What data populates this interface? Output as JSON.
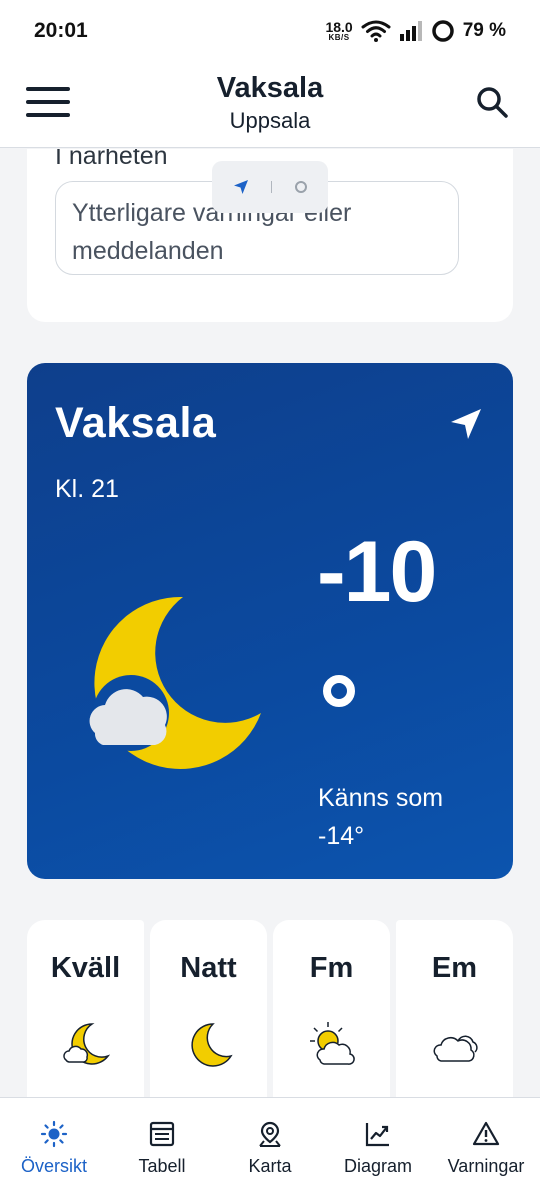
{
  "status_bar": {
    "time": "20:01",
    "net_speed_value": "18.0",
    "net_speed_unit": "KB/S",
    "battery": "79 %"
  },
  "header": {
    "title": "Vaksala",
    "subtitle": "Uppsala"
  },
  "warnings_card": {
    "heading": "I närheten",
    "more_text": "Ytterligare varningar eller meddelanden"
  },
  "current_weather": {
    "location": "Vaksala",
    "time": "Kl. 21",
    "temperature": "-10",
    "feels_like_label": "Känns som",
    "feels_like_value": "-14°",
    "icon": "moon-cloud-icon"
  },
  "periods": [
    {
      "label": "Kväll",
      "icon": "moon-cloud-icon"
    },
    {
      "label": "Natt",
      "icon": "moon-icon"
    },
    {
      "label": "Fm",
      "icon": "sun-cloud-icon"
    },
    {
      "label": "Em",
      "icon": "cloud-icon"
    }
  ],
  "bottom_nav": [
    {
      "label": "Översikt",
      "icon": "sun-icon",
      "active": true
    },
    {
      "label": "Tabell",
      "icon": "table-icon"
    },
    {
      "label": "Karta",
      "icon": "map-pin-icon"
    },
    {
      "label": "Diagram",
      "icon": "chart-icon"
    },
    {
      "label": "Varningar",
      "icon": "warning-icon"
    }
  ],
  "colors": {
    "card_blue": "#0b4aa0",
    "moon_yellow": "#f2cd00",
    "active_nav": "#1c62c7"
  }
}
